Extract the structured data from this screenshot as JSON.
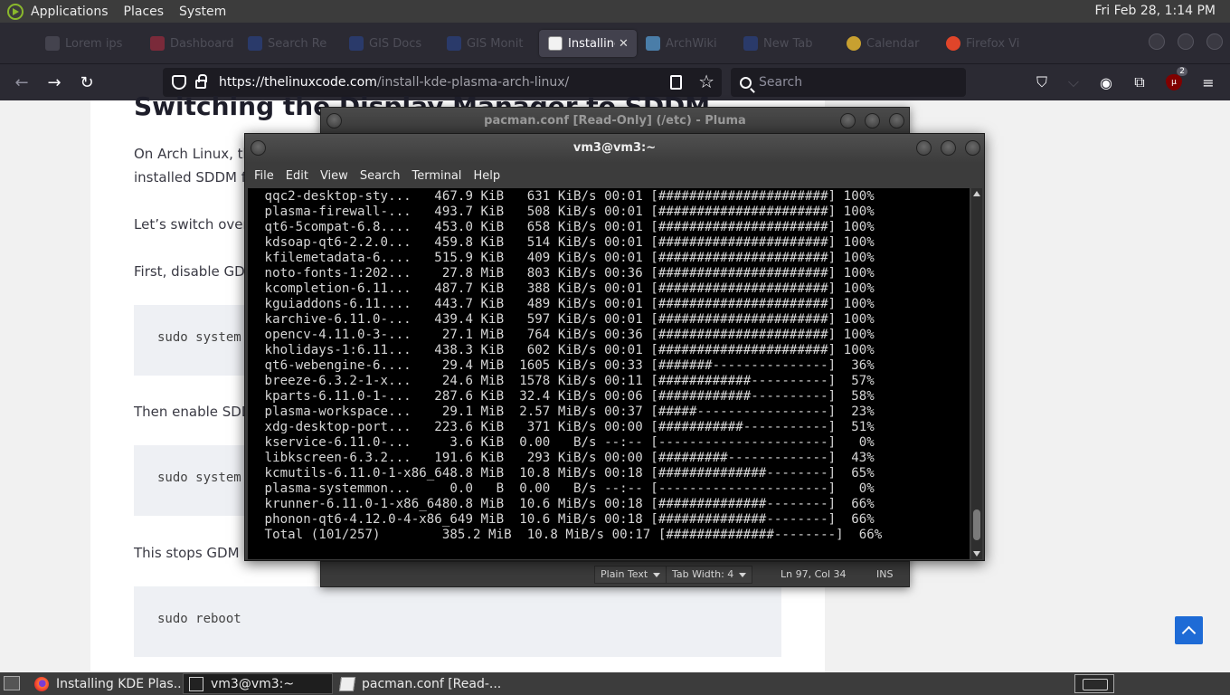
{
  "top_panel": {
    "menus": [
      "Applications",
      "Places",
      "System"
    ],
    "clock": "Fri Feb 28, 1:14 PM"
  },
  "browser": {
    "tabs": [
      {
        "label": "Lorem ips",
        "icon": "tab-favicon"
      },
      {
        "label": "Dashboard",
        "icon": "tab-favicon"
      },
      {
        "label": "Search Re",
        "icon": "tab-favicon"
      },
      {
        "label": "GIS Docs",
        "icon": "tab-favicon"
      },
      {
        "label": "GIS Monit",
        "icon": "tab-favicon"
      },
      {
        "label": "Installing",
        "icon": "site-favicon",
        "active": true
      },
      {
        "label": "ArchWiki",
        "icon": "archwiki-icon"
      },
      {
        "label": "New Tab",
        "icon": "tab-favicon"
      },
      {
        "label": "Calendar",
        "icon": "tab-favicon"
      },
      {
        "label": "Firefox Vi",
        "icon": "firefox-icon"
      }
    ],
    "url_host": "https://thelinuxcode.com",
    "url_path": "/install-kde-plasma-arch-linux/",
    "search_placeholder": "Search",
    "extension_badge": "2"
  },
  "article": {
    "heading": "Switching the Display Manager to SDDM",
    "para1_line1": "On Arch Linux, th",
    "para1_line2": "installed SDDM fo",
    "para2": "Let’s switch over",
    "para3": "First, disable GDM",
    "code1": "sudo system",
    "para4": "Then enable SDDM",
    "code2": "sudo system",
    "para5": "This stops GDM a",
    "code3": "sudo reboot"
  },
  "pluma": {
    "title": "pacman.conf [Read-Only] (/etc) - Pluma",
    "syntax": "Plain Text",
    "tab_width": "Tab Width:  4",
    "position": "Ln 97, Col 34",
    "mode": "INS"
  },
  "terminal": {
    "title": "vm3@vm3:~",
    "menus": [
      "File",
      "Edit",
      "View",
      "Search",
      "Terminal",
      "Help"
    ],
    "lines": [
      " qqc2-desktop-sty...   467.9 KiB   631 KiB/s 00:01 [######################] 100%",
      " plasma-firewall-...   493.7 KiB   508 KiB/s 00:01 [######################] 100%",
      " qt6-5compat-6.8....   453.0 KiB   658 KiB/s 00:01 [######################] 100%",
      " kdsoap-qt6-2.2.0...   459.8 KiB   514 KiB/s 00:01 [######################] 100%",
      " kfilemetadata-6....   515.9 KiB   409 KiB/s 00:01 [######################] 100%",
      " noto-fonts-1:202...    27.8 MiB   803 KiB/s 00:36 [######################] 100%",
      " kcompletion-6.11...   487.7 KiB   388 KiB/s 00:01 [######################] 100%",
      " kguiaddons-6.11....   443.7 KiB   489 KiB/s 00:01 [######################] 100%",
      " karchive-6.11.0-...   439.4 KiB   597 KiB/s 00:01 [######################] 100%",
      " opencv-4.11.0-3-...    27.1 MiB   764 KiB/s 00:36 [######################] 100%",
      " kholidays-1:6.11...   438.3 KiB   602 KiB/s 00:01 [######################] 100%",
      " qt6-webengine-6....    29.4 MiB  1605 KiB/s 00:33 [#######---------------]  36%",
      " breeze-6.3.2-1-x...    24.6 MiB  1578 KiB/s 00:11 [############----------]  57%",
      " kparts-6.11.0-1-...   287.6 KiB  32.4 KiB/s 00:06 [############----------]  58%",
      " plasma-workspace...    29.1 MiB  2.57 MiB/s 00:37 [#####-----------------]  23%",
      " xdg-desktop-port...   223.6 KiB   371 KiB/s 00:00 [###########-----------]  51%",
      " kservice-6.11.0-...     3.6 KiB  0.00   B/s --:-- [----------------------]   0%",
      " libkscreen-6.3.2...   191.6 KiB   293 KiB/s 00:00 [#########-------------]  43%",
      " kcmutils-6.11.0-1-x86_648.8 MiB  10.8 MiB/s 00:18 [##############--------]  65%",
      " plasma-systemmon...     0.0   B  0.00   B/s --:-- [----------------------]   0%",
      " krunner-6.11.0-1-x86_6480.8 MiB  10.6 MiB/s 00:18 [##############--------]  66%",
      " phonon-qt6-4.12.0-4-x86_649 MiB  10.6 MiB/s 00:18 [##############--------]  66%",
      " Total (101/257)        385.2 MiB  10.8 MiB/s 00:17 [##############--------]  66%"
    ]
  },
  "taskbar": {
    "items": [
      {
        "label": "Installing KDE Plas...",
        "icon": "firefox-icon"
      },
      {
        "label": "vm3@vm3:~",
        "icon": "terminal-icon",
        "active": true
      },
      {
        "label": "pacman.conf [Read-...",
        "icon": "text-editor-icon"
      }
    ]
  }
}
